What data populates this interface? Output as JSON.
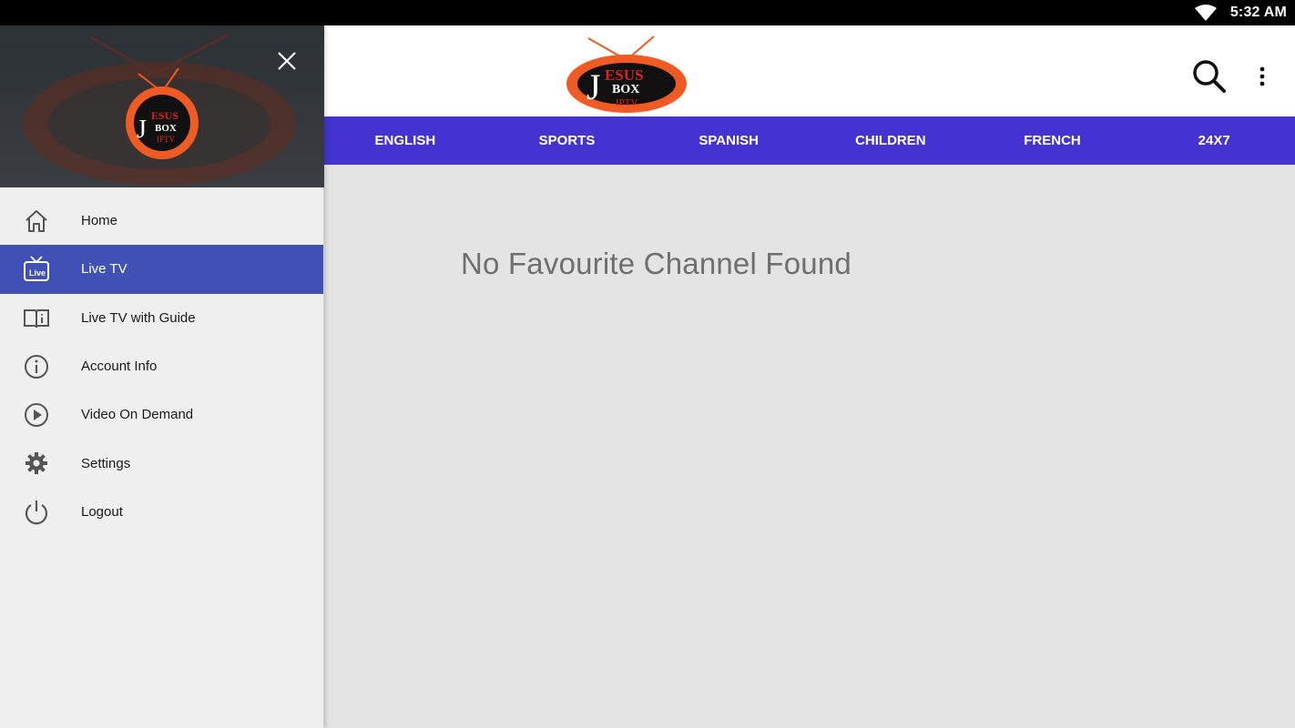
{
  "status": {
    "time": "5:32 AM"
  },
  "brand": {
    "logo_top": "ESUS",
    "logo_initial": "J",
    "logo_mid": "BOX",
    "logo_bottom": "IPTV",
    "colors": {
      "orange": "#f05a23",
      "black": "#000000",
      "red": "#e02020"
    }
  },
  "appbar": {
    "search_icon": "search-icon",
    "menu_icon": "more-vert-icon"
  },
  "tabs": [
    {
      "label": "ENGLISH"
    },
    {
      "label": "SPORTS"
    },
    {
      "label": "SPANISH"
    },
    {
      "label": "CHILDREN"
    },
    {
      "label": "FRENCH"
    },
    {
      "label": "24X7"
    }
  ],
  "content": {
    "empty_message": "No Favourite Channel Found"
  },
  "drawer": {
    "close_icon": "close-icon",
    "items": [
      {
        "label": "Home",
        "icon": "home-icon",
        "active": false
      },
      {
        "label": "Live TV",
        "icon": "live-tv-icon",
        "active": true,
        "icon_badge": "Live"
      },
      {
        "label": "Live TV with Guide",
        "icon": "guide-book-icon",
        "active": false
      },
      {
        "label": "Account Info",
        "icon": "info-icon",
        "active": false
      },
      {
        "label": "Video On Demand",
        "icon": "play-icon",
        "active": false
      },
      {
        "label": "Settings",
        "icon": "gear-icon",
        "active": false
      },
      {
        "label": "Logout",
        "icon": "power-icon",
        "active": false
      }
    ]
  },
  "theme": {
    "tab_bar": "#4433d0",
    "active_item": "#3f51b5",
    "content_bg": "#e4e4e4"
  }
}
